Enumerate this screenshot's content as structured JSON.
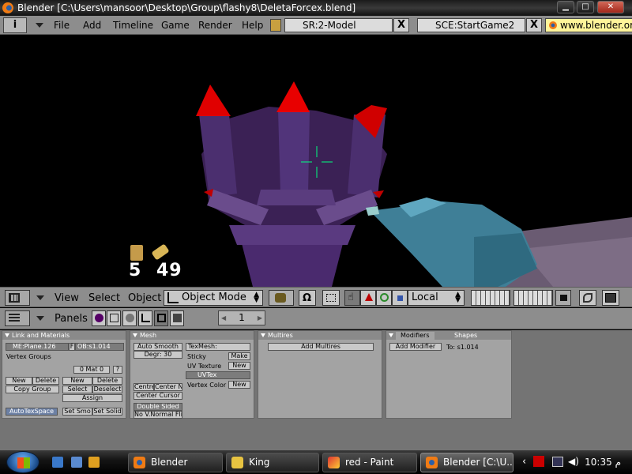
{
  "window": {
    "title": "Blender [C:\\Users\\mansoor\\Desktop\\Group\\flashy8\\DeletaForcex.blend]",
    "min_glyph": "▁",
    "max_glyph": "□",
    "close_glyph": "✕"
  },
  "menu": {
    "info_glyph": "i",
    "items": [
      "File",
      "Add",
      "Timeline",
      "Game",
      "Render",
      "Help"
    ],
    "screen": "SR:2-Model",
    "scene": "SCE:StartGame2",
    "close_glyph": "X",
    "url": "www.blender.org"
  },
  "viewport": {
    "ammo_clip": "5",
    "ammo_total": "49",
    "colors": {
      "spike": "#e00000",
      "structure": "#4a2a6e",
      "gun": "#3f7f97",
      "crosshair": "#00ff80"
    }
  },
  "view_header": {
    "items": [
      "View",
      "Select",
      "Object"
    ],
    "mode": "Object Mode",
    "orientation": "Local"
  },
  "buttons_header": {
    "panels_label": "Panels",
    "frame": "1",
    "prev_glyph": "◀",
    "next_glyph": "▶"
  },
  "panels": {
    "link": {
      "title": "Link and Materials",
      "mesh_name": "ME:Plane.126",
      "f_label": "F",
      "ob_name": "OB:s1.014",
      "vertex_groups": "Vertex Groups",
      "mat_label": "0 Mat 0",
      "mat_q": "?",
      "new": "New",
      "delete": "Delete",
      "copy_group": "Copy Group",
      "new2": "New",
      "delete2": "Delete",
      "select": "Select",
      "deselect": "Deselect",
      "assign": "Assign",
      "autotexspace": "AutoTexSpace",
      "set_smooth": "Set Smo",
      "set_solid": "Set Solid"
    },
    "mesh": {
      "title": "Mesh",
      "auto_smooth": "Auto Smooth",
      "degr": "Degr: 30",
      "texmesh": "TexMesh:",
      "sticky": "Sticky",
      "make": "Make",
      "uv_texture": "UV Texture",
      "new_uv": "New",
      "uvtex": "UVTex",
      "vertex_color": "Vertex Color",
      "new_vc": "New",
      "centre": "Centre",
      "center_new": "Center New",
      "center_cursor": "Center Cursor",
      "double_sided": "Double Sided",
      "no_vnormal": "No V.Normal Flip"
    },
    "multires": {
      "title": "Multires",
      "add": "Add Multires"
    },
    "modifiers": {
      "title": "Modifiers",
      "shapes_tab": "Shapes",
      "add_modifier": "Add Modifier",
      "to": "To: s1.014"
    }
  },
  "taskbar": {
    "tasks": [
      "Blender",
      "King",
      "red - Paint",
      "Blender [C:\\U..."
    ],
    "clock": "10:35 م"
  }
}
